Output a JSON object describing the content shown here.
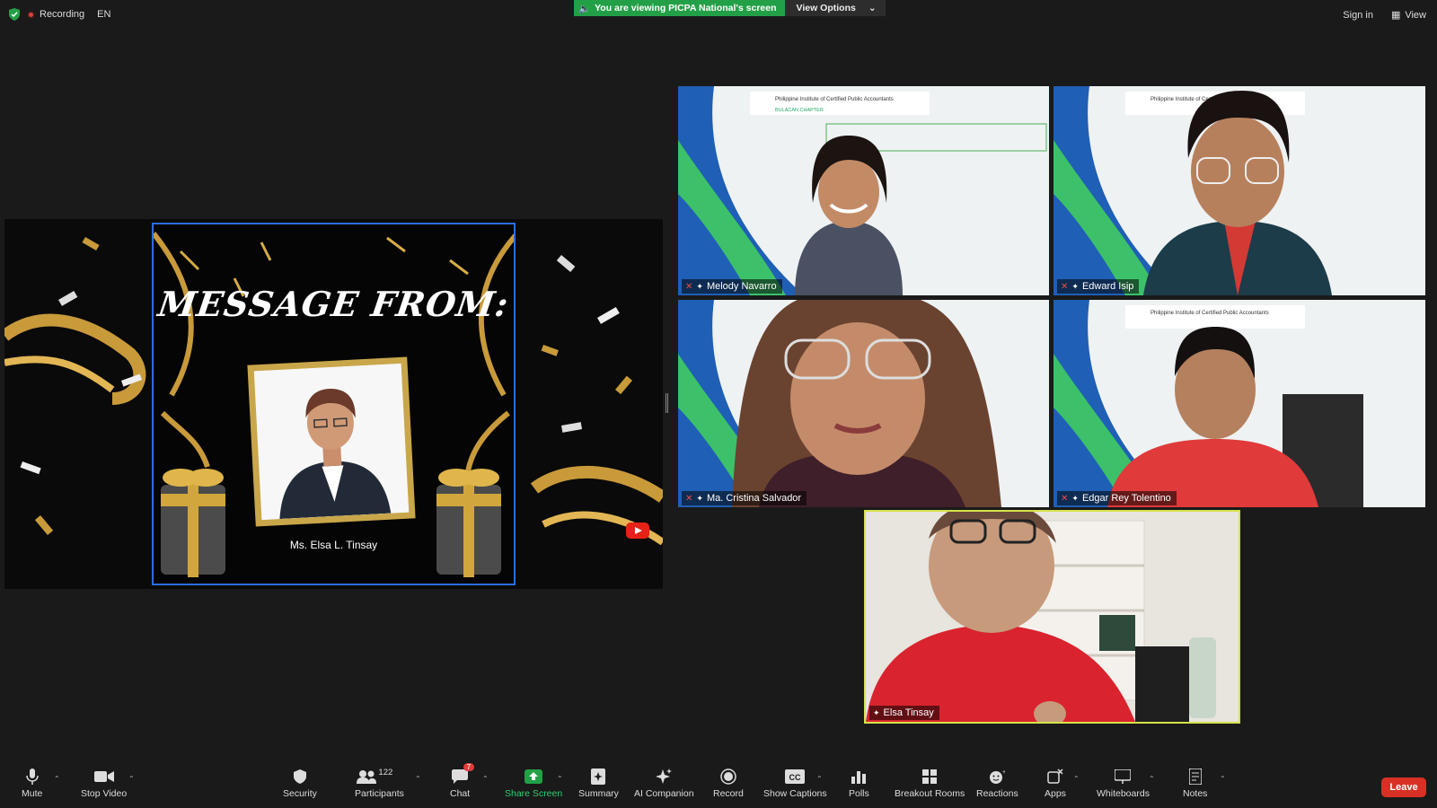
{
  "topbar": {
    "recording": "Recording",
    "language": "EN",
    "viewing_banner": "You are viewing PICPA National's screen",
    "view_options": "View Options",
    "sign_in": "Sign in",
    "view": "View"
  },
  "share": {
    "slide_title": "MESSAGE FROM:",
    "person_name": "Ms. Elsa L. Tinsay"
  },
  "participants": [
    {
      "name": "Melody Navarro",
      "muted": true
    },
    {
      "name": "Edward Isip",
      "muted": true
    },
    {
      "name": "Ma. Cristina Salvador",
      "muted": true
    },
    {
      "name": "Edgar Rey Tolentino",
      "muted": true
    },
    {
      "name": "Elsa Tinsay",
      "muted": false
    }
  ],
  "toolbar": {
    "mute": "Mute",
    "stop_video": "Stop Video",
    "security": "Security",
    "participants": "Participants",
    "participants_count": "122",
    "chat": "Chat",
    "chat_badge": "7",
    "share_screen": "Share Screen",
    "summary": "Summary",
    "ai_companion": "AI Companion",
    "record": "Record",
    "show_captions": "Show Captions",
    "polls": "Polls",
    "breakout_rooms": "Breakout Rooms",
    "reactions": "Reactions",
    "apps": "Apps",
    "whiteboards": "Whiteboards",
    "notes": "Notes",
    "leave": "Leave"
  },
  "colors": {
    "accent_green": "#23a047",
    "active_speaker": "#d6e34a",
    "leave_red": "#d93025",
    "share_border": "#2d6cdf"
  }
}
